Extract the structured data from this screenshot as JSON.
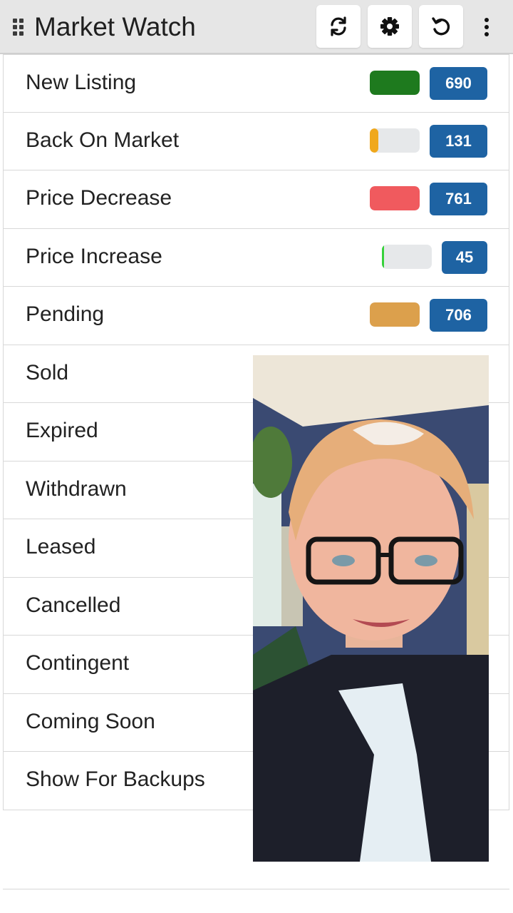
{
  "header": {
    "title": "Market Watch",
    "buttons": [
      {
        "name": "refresh-button",
        "icon": "refresh-icon"
      },
      {
        "name": "settings-button",
        "icon": "gear-icon"
      },
      {
        "name": "undo-button",
        "icon": "undo-icon"
      }
    ],
    "more_icon": "kebab-menu-icon"
  },
  "rows": [
    {
      "label": "New Listing",
      "count": "690",
      "bar_color": "#1e7a1e",
      "fill_fraction": 1.0
    },
    {
      "label": "Back On Market",
      "count": "131",
      "bar_color": "#f0a81c",
      "fill_fraction": 0.17
    },
    {
      "label": "Price Decrease",
      "count": "761",
      "bar_color": "#f05a5e",
      "fill_fraction": 1.0
    },
    {
      "label": "Price Increase",
      "count": "45",
      "bar_color": "#36d13a",
      "fill_fraction": 0.04
    },
    {
      "label": "Pending",
      "count": "706",
      "bar_color": "#dca04c",
      "fill_fraction": 1.0
    },
    {
      "label": "Sold"
    },
    {
      "label": "Expired"
    },
    {
      "label": "Withdrawn"
    },
    {
      "label": "Leased"
    },
    {
      "label": "Cancelled"
    },
    {
      "label": "Contingent"
    },
    {
      "label": "Coming Soon"
    },
    {
      "label": "Show For Backups"
    }
  ],
  "video_overlay": {
    "content": "webcam video of presenter"
  },
  "colors": {
    "badge": "#1e63a3",
    "header_bg": "#e6e6e6",
    "bar_track": "#e6e8ea"
  }
}
